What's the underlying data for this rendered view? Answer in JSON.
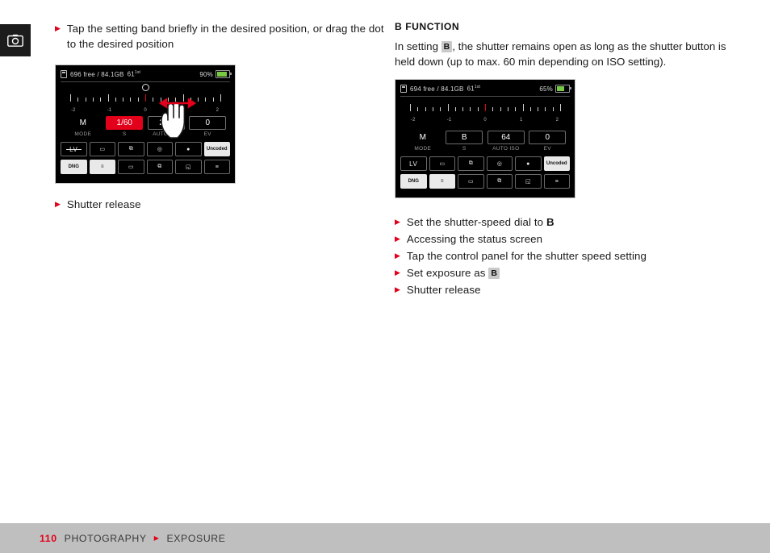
{
  "chapter_tab": {
    "icon": "camera-icon"
  },
  "left_column": {
    "instruction": "Tap the setting band briefly in the desired position, or drag the dot to the desired position",
    "after_screen_instruction": "Shutter release",
    "screen": {
      "status": {
        "card_icon": "memory-card-icon",
        "free_space": "696 free / 84.1GB",
        "shots": "61",
        "shots_sup": "1st",
        "battery_percent": "90%",
        "battery_level": 90
      },
      "scale_numbers": [
        "-2",
        "-1",
        "0",
        "1",
        "2"
      ],
      "panel": [
        {
          "value": "M",
          "label": "MODE",
          "style": "plain"
        },
        {
          "value": "1/60",
          "label": "S",
          "style": "red"
        },
        {
          "value": "200",
          "label": "AUTO ISO",
          "style": "box"
        },
        {
          "value": "0",
          "label": "EV",
          "style": "box"
        }
      ],
      "icon_row_1": [
        "LV",
        "▭",
        "⧉",
        "◎",
        "●",
        "Uncoded"
      ],
      "icon_row_2": [
        "DNG",
        "≡",
        "▭",
        "⧉",
        "◱",
        "≡"
      ],
      "lv_strikethrough": true,
      "gesture": "drag-hand-gesture"
    }
  },
  "right_column": {
    "heading": "B FUNCTION",
    "paragraph_part1": "In setting ",
    "paragraph_key": "B",
    "paragraph_part2": ", the shutter remains open as long as the shutter button is held down (up to max. 60 min depending on ISO setting).",
    "screen": {
      "status": {
        "card_icon": "memory-card-icon",
        "free_space": "694 free / 84.1GB",
        "shots": "61",
        "shots_sup": "1st",
        "battery_percent": "65%",
        "battery_level": 65
      },
      "scale_numbers": [
        "-2",
        "-1",
        "0",
        "1",
        "2"
      ],
      "panel": [
        {
          "value": "M",
          "label": "MODE",
          "style": "plain"
        },
        {
          "value": "B",
          "label": "S",
          "style": "box"
        },
        {
          "value": "64",
          "label": "AUTO ISO",
          "style": "box"
        },
        {
          "value": "0",
          "label": "EV",
          "style": "box"
        }
      ],
      "icon_row_1": [
        "LV",
        "▭",
        "⧉",
        "◎",
        "●",
        "Uncoded"
      ],
      "icon_row_2": [
        "DNG",
        "≡",
        "▭",
        "⧉",
        "◱",
        "≡"
      ],
      "lv_strikethrough": false
    },
    "steps": [
      {
        "text_before": "Set the shutter-speed dial to ",
        "key": "B",
        "key_style": "bold",
        "text_after": ""
      },
      {
        "text_before": "Accessing the status screen",
        "key": "",
        "key_style": "none",
        "text_after": ""
      },
      {
        "text_before": "Tap the control panel for the shutter speed setting",
        "key": "",
        "key_style": "none",
        "text_after": ""
      },
      {
        "text_before": "Set exposure as ",
        "key": "B",
        "key_style": "boxed",
        "text_after": ""
      },
      {
        "text_before": "Shutter release",
        "key": "",
        "key_style": "none",
        "text_after": ""
      }
    ]
  },
  "footer": {
    "page": "110",
    "chapter": "PHOTOGRAPHY",
    "section": "EXPOSURE"
  },
  "colors": {
    "accent": "#e2001a",
    "footer_bg": "#bfbfbf",
    "tab_bg": "#1c1c1c",
    "screen_bg": "#000000"
  }
}
